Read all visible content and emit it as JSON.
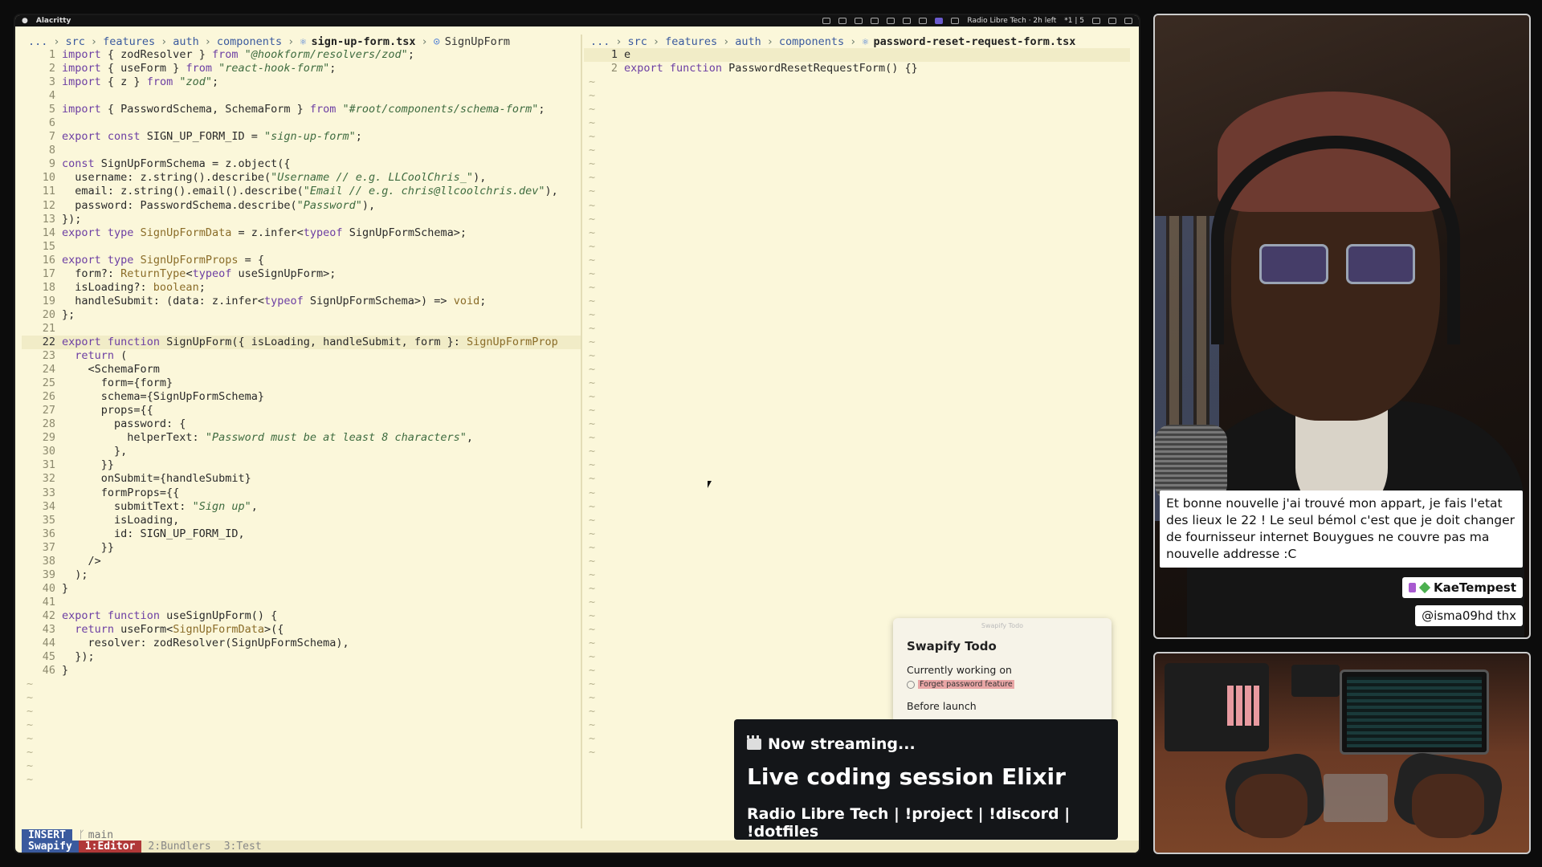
{
  "menubar": {
    "app": "Alacritty",
    "status_text": "Radio Libre Tech · 2h left",
    "counter": "*1 | 5"
  },
  "left_pane": {
    "breadcrumb": [
      "...",
      "src",
      "features",
      "auth",
      "components"
    ],
    "file": "sign-up-form.tsx",
    "symbol": "SignUpForm",
    "lines": [
      "import { zodResolver } from \"@hookform/resolvers/zod\";",
      "import { useForm } from \"react-hook-form\";",
      "import { z } from \"zod\";",
      "",
      "import { PasswordSchema, SchemaForm } from \"#root/components/schema-form\";",
      "",
      "export const SIGN_UP_FORM_ID = \"sign-up-form\";",
      "",
      "const SignUpFormSchema = z.object({",
      "  username: z.string().describe(\"Username // e.g. LLCoolChris_\"),",
      "  email: z.string().email().describe(\"Email // e.g. chris@llcoolchris.dev\"),",
      "  password: PasswordSchema.describe(\"Password\"),",
      "});",
      "export type SignUpFormData = z.infer<typeof SignUpFormSchema>;",
      "",
      "export type SignUpFormProps = {",
      "  form?: ReturnType<typeof useSignUpForm>;",
      "  isLoading?: boolean;",
      "  handleSubmit: (data: z.infer<typeof SignUpFormSchema>) => void;",
      "};",
      "",
      "export function SignUpForm({ isLoading, handleSubmit, form }: SignUpFormProp",
      "  return (",
      "    <SchemaForm",
      "      form={form}",
      "      schema={SignUpFormSchema}",
      "      props={{",
      "        password: {",
      "          helperText: \"Password must be at least 8 characters\",",
      "        },",
      "      }}",
      "      onSubmit={handleSubmit}",
      "      formProps={{",
      "        submitText: \"Sign up\",",
      "        isLoading,",
      "        id: SIGN_UP_FORM_ID,",
      "      }}",
      "    />",
      "  );",
      "}",
      "",
      "export function useSignUpForm() {",
      "  return useForm<SignUpFormData>({",
      "    resolver: zodResolver(SignUpFormSchema),",
      "  });",
      "}"
    ],
    "current_line": 22
  },
  "right_pane": {
    "breadcrumb": [
      "...",
      "src",
      "features",
      "auth",
      "components"
    ],
    "file": "password-reset-request-form.tsx",
    "lines": [
      "e",
      "export function PasswordResetRequestForm() {}"
    ],
    "current_line": 1
  },
  "status": {
    "mode": "INSERT",
    "branch": "main"
  },
  "tmux": {
    "session": "Swapify",
    "windows": [
      {
        "label": "1:Editor",
        "active": true
      },
      {
        "label": "2:Bundlers",
        "active": false
      },
      {
        "label": "3:Test",
        "active": false
      }
    ]
  },
  "todo": {
    "header": "Swapify Todo",
    "title": "Swapify Todo",
    "section1": "Currently working on",
    "item1": "Forget password feature",
    "section2": "Before launch"
  },
  "banner": {
    "now": "Now streaming...",
    "title": "Live coding session Elixir",
    "links": "Radio Libre Tech | !project | !discord | !dotfiles"
  },
  "chat": {
    "message": "Et bonne nouvelle j'ai trouvé mon appart, je fais l'etat des lieux le 22 ! Le seul bémol c'est que je doit changer de fournisseur internet Bouygues ne couvre pas ma nouvelle addresse :C",
    "username": "KaeTempest",
    "reply": "@isma09hd thx"
  }
}
